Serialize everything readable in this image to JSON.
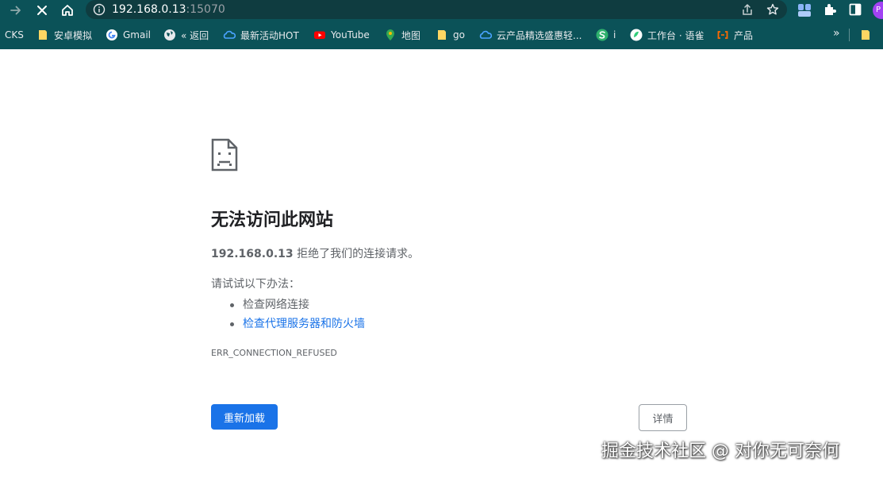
{
  "browser": {
    "url_host": "192.168.0.13",
    "url_port": ":15070",
    "theme_color": "#0b5258",
    "profile_initial": "P"
  },
  "bookmarks": [
    {
      "label": "CKS",
      "icon": "none"
    },
    {
      "label": "安卓模拟",
      "icon": "folder-icon"
    },
    {
      "label": "Gmail",
      "icon": "google-icon"
    },
    {
      "label": "« 返回",
      "icon": "globe-icon"
    },
    {
      "label": "最新活动HOT",
      "icon": "cloud-icon"
    },
    {
      "label": "YouTube",
      "icon": "youtube-icon"
    },
    {
      "label": "地图",
      "icon": "maps-icon"
    },
    {
      "label": "go",
      "icon": "folder-icon"
    },
    {
      "label": "云产品精选盛惠轻...",
      "icon": "cloud-icon"
    },
    {
      "label": "i",
      "icon": "s-logo-icon"
    },
    {
      "label": "工作台 · 语雀",
      "icon": "yuque-icon"
    },
    {
      "label": "产品",
      "icon": "alicloud-icon"
    }
  ],
  "error_page": {
    "title": "无法访问此网站",
    "host": "192.168.0.13",
    "description": " 拒绝了我们的连接请求。",
    "try_heading": "请试试以下办法：",
    "suggestions": [
      "检查网络连接",
      "检查代理服务器和防火墙"
    ],
    "error_code": "ERR_CONNECTION_REFUSED",
    "reload_label": "重新加载",
    "details_label": "详情"
  },
  "watermark": "掘金技术社区 @ 对你无可奈何",
  "colors": {
    "accent_blue": "#1a73e8",
    "text_primary": "#202124",
    "text_secondary": "#5f6368"
  }
}
